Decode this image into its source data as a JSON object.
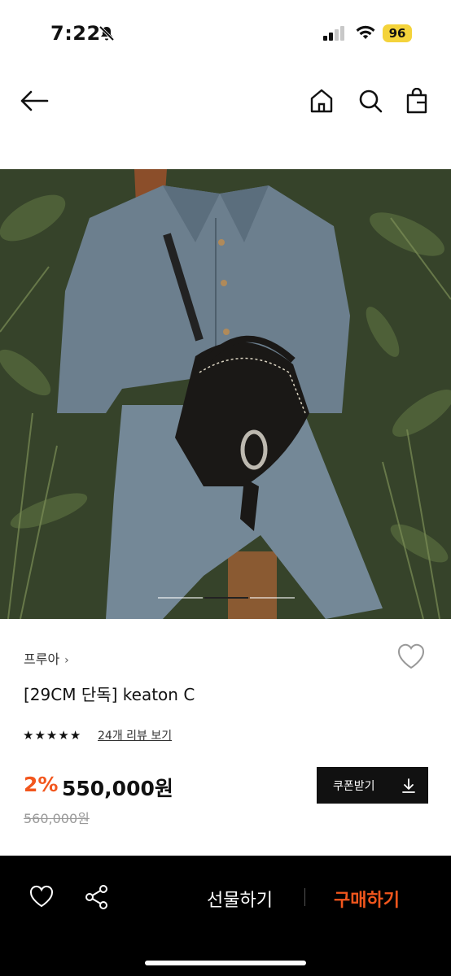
{
  "status_bar": {
    "time": "7:22",
    "battery": "96"
  },
  "product": {
    "brand": "프루아",
    "brand_chevron": "›",
    "title": "[29CM 단독] keaton C",
    "rating_stars": 5,
    "review_link": "24개 리뷰 보기",
    "discount": "2%",
    "price": "550,000원",
    "original_price": "560,000원"
  },
  "coupon_button": {
    "label": "쿠폰받기",
    "icon": "download-icon"
  },
  "image_pager": {
    "total": 3,
    "active": 1
  },
  "bottom_bar": {
    "gift_label": "선물하기",
    "buy_label": "구매하기"
  },
  "colors": {
    "accent": "#f2561d",
    "dark": "#111111",
    "bottom_bg": "#000000"
  }
}
